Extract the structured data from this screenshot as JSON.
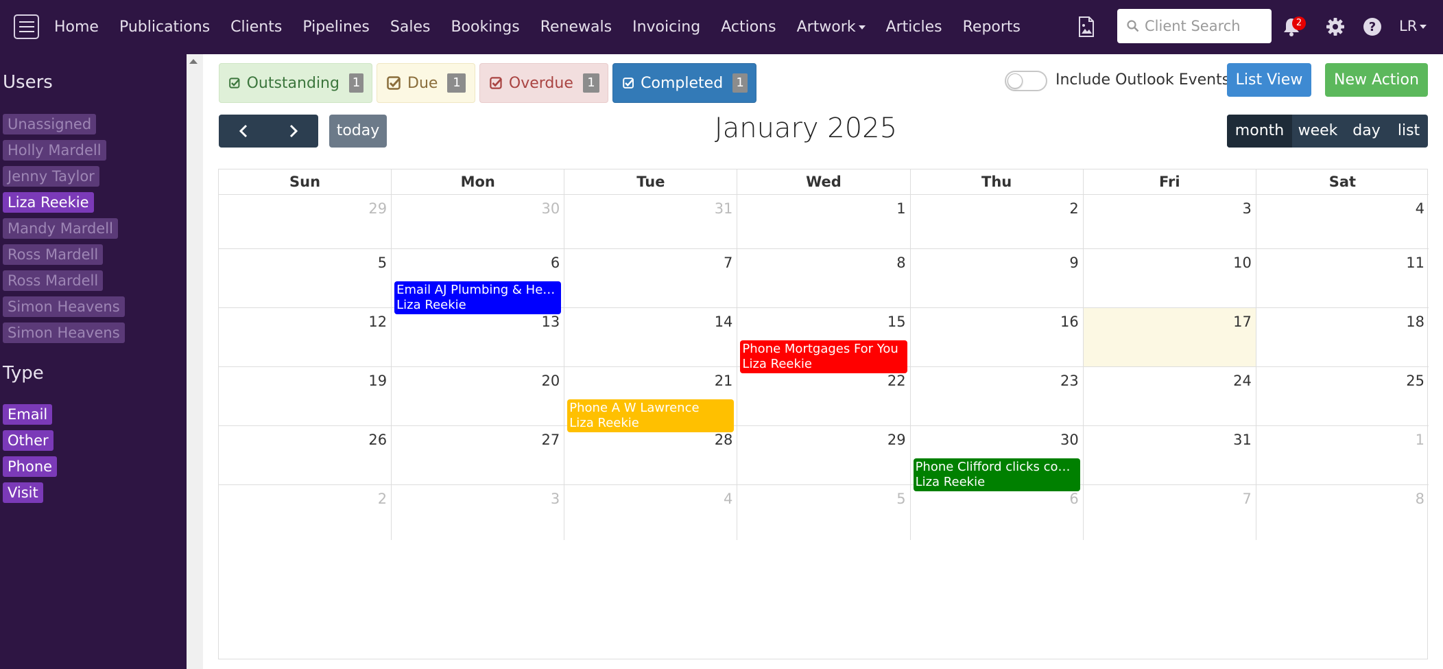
{
  "nav": {
    "links": [
      "Home",
      "Publications",
      "Clients",
      "Pipelines",
      "Sales",
      "Bookings",
      "Renewals",
      "Invoicing",
      "Actions",
      "Artwork",
      "Articles",
      "Reports"
    ],
    "search_placeholder": "Client Search",
    "notification_count": "2",
    "user_initials": "LR"
  },
  "sidebar": {
    "users_heading": "Users",
    "users": [
      "Unassigned",
      "Holly Mardell",
      "Jenny Taylor",
      "Liza Reekie",
      "Mandy Mardell",
      "Ross Mardell",
      "Ross Mardell",
      "Simon Heavens",
      "Simon Heavens"
    ],
    "active_user": "Liza Reekie",
    "type_heading": "Type",
    "types": [
      "Email",
      "Other",
      "Phone",
      "Visit"
    ]
  },
  "filters": {
    "outstanding": {
      "label": "Outstanding",
      "count": "1"
    },
    "due": {
      "label": "Due",
      "count": "1"
    },
    "overdue": {
      "label": "Overdue",
      "count": "1"
    },
    "completed": {
      "label": "Completed",
      "count": "1"
    }
  },
  "toolbar": {
    "include_outlook_label": "Include Outlook Events",
    "list_view_label": "List View",
    "new_action_label": "New Action",
    "today_label": "today",
    "title": "January 2025",
    "views": [
      "month",
      "week",
      "day",
      "list"
    ],
    "active_view": "month"
  },
  "calendar": {
    "weekdays": [
      "Sun",
      "Mon",
      "Tue",
      "Wed",
      "Thu",
      "Fri",
      "Sat"
    ],
    "weeks": [
      [
        "29",
        "30",
        "31",
        "1",
        "2",
        "3",
        "4"
      ],
      [
        "5",
        "6",
        "7",
        "8",
        "9",
        "10",
        "11"
      ],
      [
        "12",
        "13",
        "14",
        "15",
        "16",
        "17",
        "18"
      ],
      [
        "19",
        "20",
        "21",
        "22",
        "23",
        "24",
        "25"
      ],
      [
        "26",
        "27",
        "28",
        "29",
        "30",
        "31",
        "1"
      ],
      [
        "2",
        "3",
        "4",
        "5",
        "6",
        "7",
        "8"
      ]
    ],
    "events": [
      {
        "week": 1,
        "day": 1,
        "title": "Email AJ Plumbing & Heating",
        "user": "Liza Reekie",
        "color": "#0000ff"
      },
      {
        "week": 2,
        "day": 3,
        "title": "Phone Mortgages For You",
        "user": "Liza Reekie",
        "color": "#ff0000"
      },
      {
        "week": 3,
        "day": 2,
        "title": "Phone A W Lawrence",
        "user": "Liza Reekie",
        "color": "#ffc000"
      },
      {
        "week": 4,
        "day": 4,
        "title": "Phone Clifford clicks comp...",
        "user": "Liza Reekie",
        "color": "#008000"
      }
    ]
  }
}
